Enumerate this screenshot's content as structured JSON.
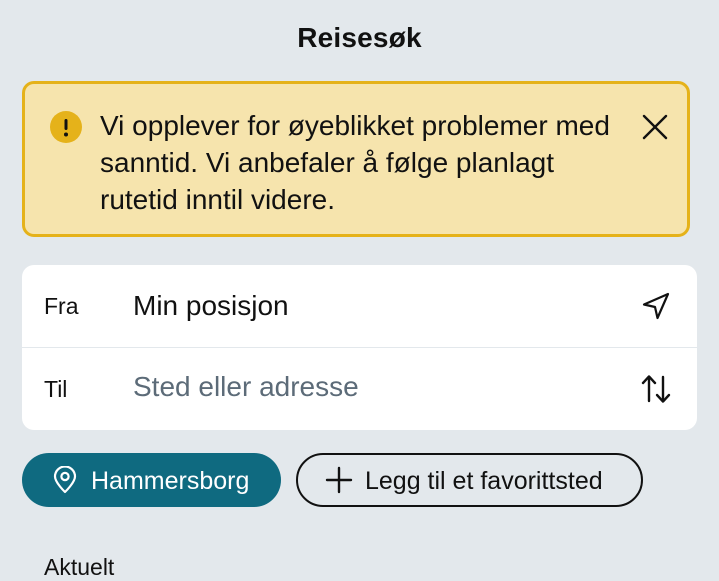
{
  "header": {
    "title": "Reisesøk"
  },
  "alert": {
    "icon": "warning-icon",
    "message": "Vi opplever for øyeblikket problemer med sanntid. Vi anbefaler å følge planlagt rutetid inntil videre.",
    "close_icon": "close-icon",
    "background": "#f6e4ad",
    "border": "#e5b21a"
  },
  "search": {
    "from_label": "Fra",
    "from_value": "Min posisjon",
    "from_icon": "location-arrow-icon",
    "to_label": "Til",
    "to_placeholder": "Sted eller adresse",
    "swap_icon": "swap-icon"
  },
  "favorites": {
    "items": [
      {
        "label": "Hammersborg",
        "icon": "location-pin-icon"
      }
    ],
    "add_label": "Legg til et favorittsted",
    "add_icon": "plus-icon",
    "accent": "#0f6a80"
  },
  "sections": {
    "current_title": "Aktuelt"
  }
}
